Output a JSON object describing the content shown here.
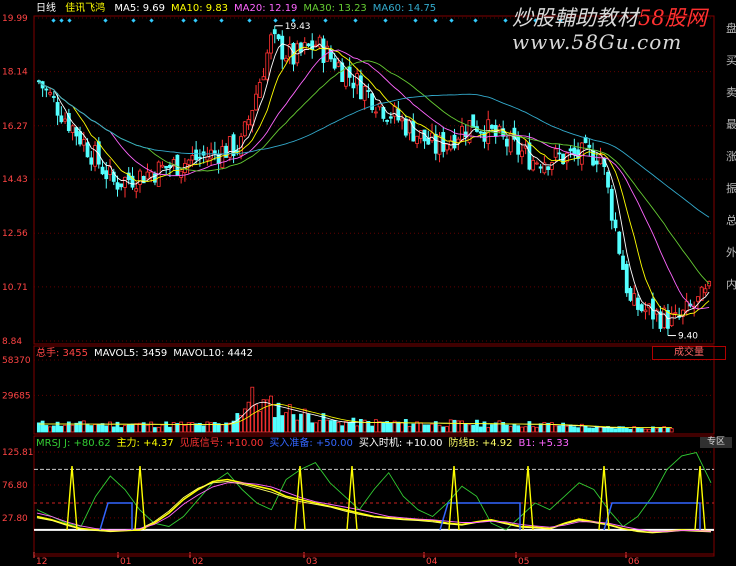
{
  "header": {
    "period": "日线",
    "stock_name": "佳讯飞鸿",
    "ma": [
      {
        "label": "MA5: 9.69",
        "color": "#ffffff"
      },
      {
        "label": "MA10: 9.83",
        "color": "#ffff00"
      },
      {
        "label": "MA20: 12.19",
        "color": "#ff66ff"
      },
      {
        "label": "MA30: 13.23",
        "color": "#66cc33"
      },
      {
        "label": "MA60: 14.75",
        "color": "#33aacc"
      }
    ]
  },
  "watermark": {
    "main": "炒股輔助教材",
    "brand": "58股网",
    "url": "www.58Gu.com"
  },
  "side_chars": [
    "盘",
    "买",
    "卖",
    "最",
    "涨",
    "振",
    "总",
    "外",
    "内"
  ],
  "volume_header": {
    "items": [
      {
        "label": "总手: 3455",
        "color": "#ff4444"
      },
      {
        "label": "MAVOL5: 3459",
        "color": "#ffffff"
      },
      {
        "label": "MAVOL10: 4442",
        "color": "#ffffff"
      }
    ],
    "button": "成交量"
  },
  "indicator_header": {
    "items": [
      {
        "label": "MRSJ J: +80.62",
        "color": "#33cc33"
      },
      {
        "label": "主力: +4.37",
        "color": "#ffff00"
      },
      {
        "label": "见底信号: +10.00",
        "color": "#ff3333"
      },
      {
        "label": "买入准备: +50.00",
        "color": "#3366ff"
      },
      {
        "label": "买入时机: +10.00",
        "color": "#ffffff"
      },
      {
        "label": "防线B: +4.92",
        "color": "#ffff66"
      },
      {
        "label": "B1: +5.33",
        "color": "#ff66ff"
      }
    ],
    "button": "专区"
  },
  "chart_data": [
    {
      "type": "candlestick",
      "title": "佳讯飞鸿 日线",
      "ylim": [
        8.84,
        19.99
      ],
      "y_ticks": [
        "19.99",
        "18.14",
        "16.27",
        "14.43",
        "12.56",
        "10.71",
        "8.84"
      ],
      "annotations": [
        {
          "label": "19.43",
          "role": "high"
        },
        {
          "label": "9.40",
          "role": "low"
        }
      ],
      "segments": [
        {
          "n": 20,
          "start": 17.8,
          "end": 14.3
        },
        {
          "n": 8,
          "start": 14.3,
          "end": 14.6
        },
        {
          "n": 26,
          "start": 14.6,
          "end": 15.6
        },
        {
          "n": 8,
          "start": 15.6,
          "end": 19.2
        },
        {
          "n": 6,
          "start": 19.2,
          "end": 18.6
        },
        {
          "n": 6,
          "start": 18.6,
          "end": 19.1
        },
        {
          "n": 18,
          "start": 19.1,
          "end": 16.9
        },
        {
          "n": 14,
          "start": 16.9,
          "end": 15.5
        },
        {
          "n": 10,
          "start": 15.5,
          "end": 16.4
        },
        {
          "n": 16,
          "start": 16.4,
          "end": 15.1
        },
        {
          "n": 18,
          "start": 15.1,
          "end": 15.3
        },
        {
          "n": 8,
          "start": 15.3,
          "end": 10.1
        },
        {
          "n": 12,
          "start": 10.1,
          "end": 9.5
        },
        {
          "n": 10,
          "start": 9.5,
          "end": 10.6
        }
      ]
    },
    {
      "type": "bar",
      "title": "成交量",
      "ylim": [
        0,
        58370
      ],
      "y_ticks": [
        "58370",
        "29685"
      ],
      "segments": [
        {
          "n": 50,
          "start": 6500,
          "end": 6000
        },
        {
          "n": 8,
          "start": 6000,
          "end": 30000
        },
        {
          "n": 20,
          "start": 24000,
          "end": 9000
        },
        {
          "n": 60,
          "start": 8000,
          "end": 6000
        },
        {
          "n": 10,
          "start": 5500,
          "end": 4500
        },
        {
          "n": 12,
          "start": 3500,
          "end": 3600
        },
        {
          "n": 10,
          "start": 3600,
          "end": 3500
        }
      ]
    },
    {
      "type": "line",
      "title": "MRSJ",
      "ylim": [
        -5,
        125.81
      ],
      "y_ticks": [
        "125.81",
        "76.80",
        "27.80"
      ],
      "series": [
        {
          "name": "J",
          "color": "#33cc33",
          "values": [
            40,
            30,
            20,
            15,
            60,
            90,
            70,
            40,
            20,
            15,
            30,
            55,
            80,
            95,
            70,
            50,
            40,
            85,
            100,
            110,
            80,
            60,
            40,
            70,
            95,
            60,
            40,
            30,
            50,
            75,
            60,
            20,
            10,
            30,
            50,
            40,
            60,
            80,
            70,
            40,
            15,
            30,
            60,
            100,
            120,
            125,
            80
          ]
        },
        {
          "name": "主力",
          "color": "#ffff00",
          "values": [
            30,
            25,
            18,
            12,
            10,
            8,
            9,
            10,
            20,
            35,
            55,
            70,
            82,
            85,
            80,
            75,
            70,
            60,
            55,
            50,
            45,
            40,
            35,
            30,
            28,
            26,
            25,
            24,
            20,
            18,
            22,
            25,
            20,
            15,
            14,
            12,
            20,
            26,
            22,
            18,
            12,
            8,
            6,
            8,
            10,
            9,
            8
          ]
        },
        {
          "name": "防线B",
          "color": "#ffff66",
          "values": [
            28,
            24,
            17,
            11,
            9,
            8,
            9,
            11,
            22,
            38,
            58,
            72,
            80,
            82,
            78,
            72,
            66,
            58,
            52,
            48,
            44,
            38,
            33,
            29,
            27,
            25,
            24,
            22,
            19,
            17,
            21,
            24,
            19,
            14,
            13,
            11,
            19,
            24,
            21,
            17,
            11,
            8,
            6,
            7,
            9,
            8,
            7
          ]
        },
        {
          "name": "B1",
          "color": "#ff66ff",
          "values": [
            35,
            30,
            22,
            16,
            12,
            10,
            10,
            12,
            18,
            30,
            48,
            62,
            74,
            80,
            80,
            78,
            74,
            66,
            58,
            52,
            48,
            44,
            40,
            35,
            30,
            28,
            26,
            25,
            23,
            21,
            21,
            23,
            22,
            18,
            16,
            14,
            17,
            22,
            22,
            20,
            15,
            11,
            8,
            8,
            9,
            9,
            8
          ]
        }
      ]
    }
  ],
  "x_axis": {
    "labels": [
      "12",
      "01",
      "02",
      "03",
      "04",
      "05",
      "06"
    ]
  }
}
